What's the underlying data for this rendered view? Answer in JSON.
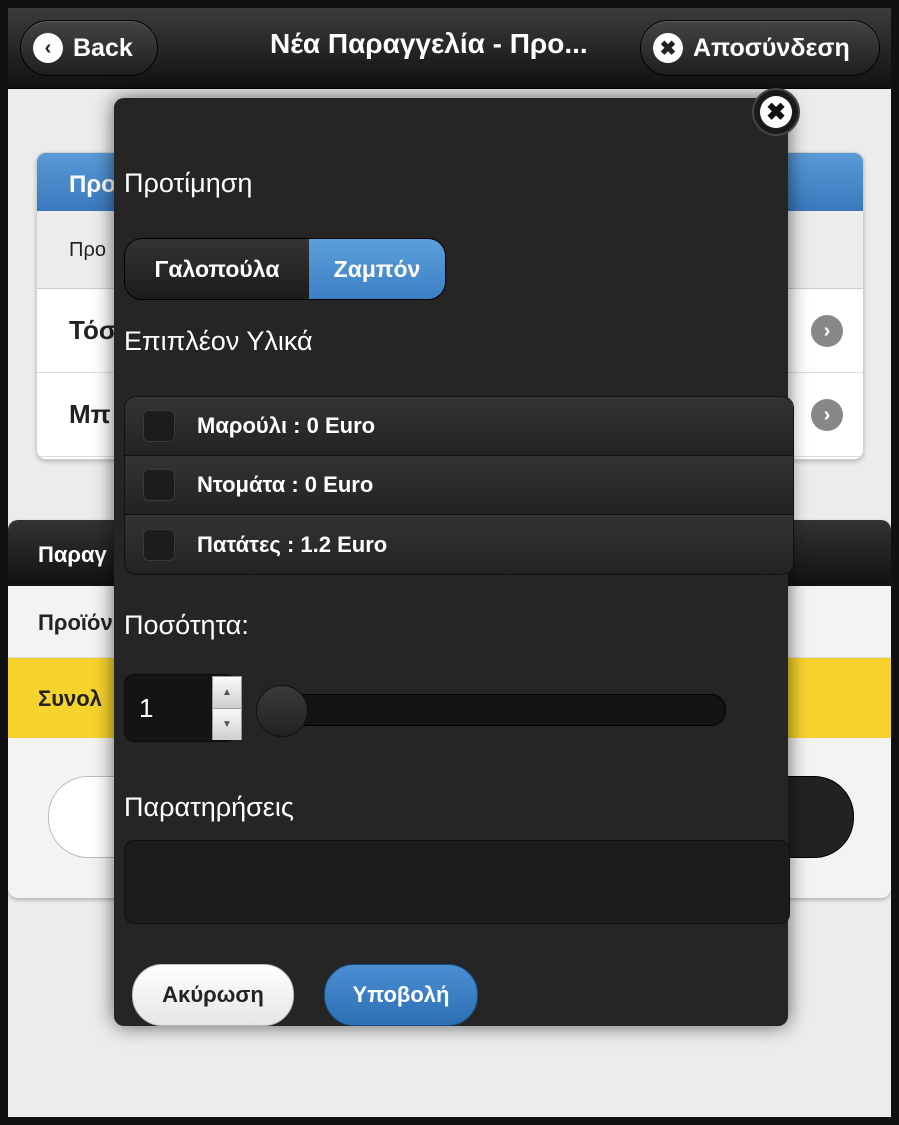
{
  "header": {
    "back_label": "Back",
    "title": "Νέα Παραγγελία - Προ...",
    "logout_label": "Αποσύνδεση",
    "back_icon": "chevron-left-icon",
    "logout_icon": "close-icon"
  },
  "background": {
    "card1_head": "Προ",
    "card1_sub": "Προ",
    "card1_row1": "Τόσ",
    "card1_row2": "Μπ",
    "card2_head": "Παραγ",
    "card2_row": "Προϊόν",
    "card2_total": "Συνολ"
  },
  "dialog": {
    "preference_label": "Προτίμηση",
    "preference_options": [
      "Γαλοπούλα",
      "Ζαμπόν"
    ],
    "selected_option": "Ζαμπόν",
    "extras_label": "Επιπλέον Υλικά",
    "extras": [
      {
        "label": "Μαρούλι : 0 Euro",
        "checked": false
      },
      {
        "label": "Ντομάτα : 0 Euro",
        "checked": false
      },
      {
        "label": "Πατάτες : 1.2 Euro",
        "checked": false
      }
    ],
    "quantity_label": "Ποσότητα:",
    "quantity_value": "1",
    "notes_label": "Παρατηρήσεις",
    "notes_value": "",
    "cancel_label": "Ακύρωση",
    "submit_label": "Υποβολή"
  },
  "colors": {
    "accent_blue": "#3b80c4",
    "total_yellow": "#f6d32c",
    "dialog_bg": "#252525"
  }
}
